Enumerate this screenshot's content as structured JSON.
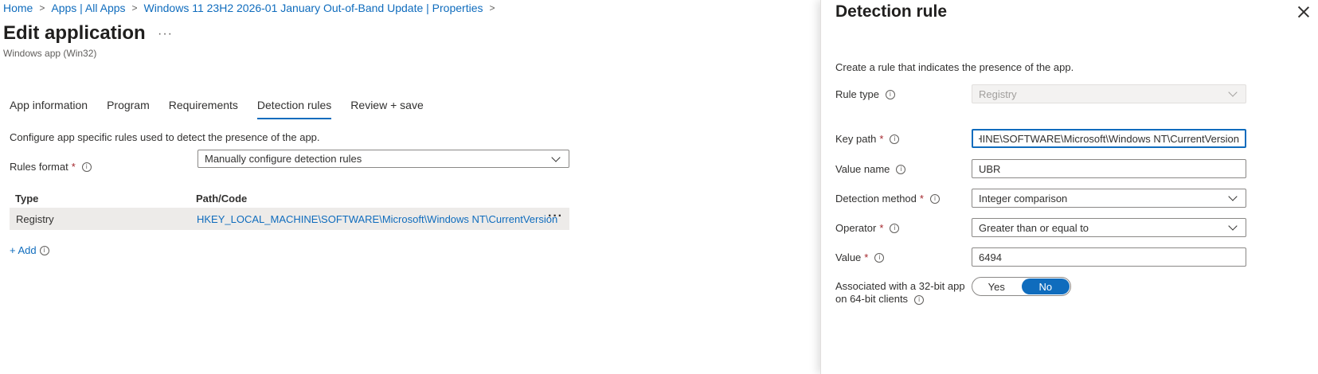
{
  "breadcrumb": {
    "items": [
      "Home",
      "Apps | All Apps",
      "Windows 11 23H2 2026-01 January Out-of-Band Update | Properties"
    ],
    "separator": ">"
  },
  "page": {
    "title": "Edit application",
    "more": "···",
    "subtitle": "Windows app (Win32)"
  },
  "tabs": [
    {
      "label": "App information"
    },
    {
      "label": "Program"
    },
    {
      "label": "Requirements"
    },
    {
      "label": "Detection rules",
      "active": true
    },
    {
      "label": "Review + save"
    }
  ],
  "main": {
    "description": "Configure app specific rules used to detect the presence of the app.",
    "rules_format_label": "Rules format",
    "required_mark": "*",
    "rules_format_value": "Manually configure detection rules",
    "table": {
      "headers": [
        "Type",
        "Path/Code"
      ],
      "rows": [
        {
          "type": "Registry",
          "path": "HKEY_LOCAL_MACHINE\\SOFTWARE\\Microsoft\\Windows NT\\CurrentVersion",
          "more": "···"
        }
      ]
    },
    "add_label": "+ Add"
  },
  "panel": {
    "title": "Detection rule",
    "description": "Create a rule that indicates the presence of the app.",
    "rule_type_label": "Rule type",
    "rule_type_value": "Registry",
    "key_path_label": "Key path",
    "key_path_value": "HKEY_LOCAL_MACHINE\\SOFTWARE\\Microsoft\\Windows NT\\CurrentVersion",
    "value_name_label": "Value name",
    "value_name_value": "UBR",
    "detection_method_label": "Detection method",
    "detection_method_value": "Integer comparison",
    "operator_label": "Operator",
    "operator_value": "Greater than or equal to",
    "value_label": "Value",
    "value_value": "6494",
    "assoc_label_line1": "Associated with a 32-bit app",
    "assoc_label_line2": "on 64-bit clients",
    "toggle_yes": "Yes",
    "toggle_no": "No",
    "toggle_selected": "No"
  },
  "colors": {
    "accent": "#0f6cbd",
    "required": "#a4262c",
    "row_highlight": "#edebe9"
  },
  "icons": {
    "info": "info-icon",
    "close": "close-icon",
    "chevron": "chevron-down-icon",
    "more": "more-icon"
  }
}
